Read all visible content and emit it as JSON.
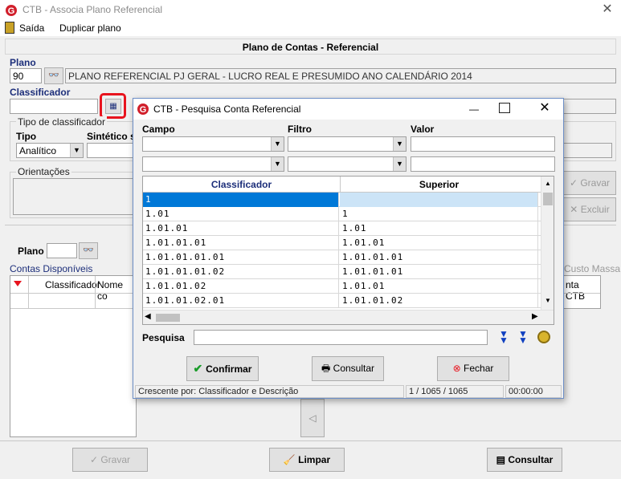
{
  "window": {
    "title": "CTB - Associa Plano Referencial",
    "close": "✕"
  },
  "menu": {
    "exit": "Saída",
    "duplicate": "Duplicar plano"
  },
  "section_title": "Plano de Contas - Referencial",
  "plano": {
    "label": "Plano",
    "value": "90",
    "description": "PLANO REFERENCIAL PJ GERAL - LUCRO REAL E PRESUMIDO ANO CALENDÁRIO 2014"
  },
  "classificador": {
    "label": "Classificador"
  },
  "tipo_group": {
    "label": "Tipo de classificador",
    "tipo_label": "Tipo",
    "tipo_value": "Analítico",
    "sintetico_label": "Sintético s"
  },
  "orientacoes": {
    "label": "Orientações"
  },
  "side_buttons": {
    "gravar": "Gravar",
    "excluir": "Excluir"
  },
  "lower": {
    "plano_label": "Plano",
    "contas_label": "Contas Disponíveis",
    "custo_massa": "Custo Massa",
    "columns": [
      "Classificador",
      "Nome co"
    ],
    "right_col": "nta CTB"
  },
  "bottom": {
    "gravar": "Gravar",
    "limpar": "Limpar",
    "consultar": "Consultar"
  },
  "dialog": {
    "title": "CTB - Pesquisa Conta Referencial",
    "campo": "Campo",
    "filtro": "Filtro",
    "valor": "Valor",
    "columns": [
      "Classificador",
      "Superior"
    ],
    "rows": [
      {
        "c": "1",
        "s": ""
      },
      {
        "c": "1.01",
        "s": "1"
      },
      {
        "c": "1.01.01",
        "s": "1.01"
      },
      {
        "c": "1.01.01.01",
        "s": "1.01.01"
      },
      {
        "c": "1.01.01.01.01",
        "s": "1.01.01.01"
      },
      {
        "c": "1.01.01.01.02",
        "s": "1.01.01.01"
      },
      {
        "c": "1.01.01.02",
        "s": "1.01.01"
      },
      {
        "c": "1.01.01.02.01",
        "s": "1.01.01.02"
      }
    ],
    "pesquisa": "Pesquisa",
    "confirmar": "Confirmar",
    "consultar": "Consultar",
    "fechar": "Fechar",
    "status": {
      "order": "Crescente por: Classificador e Descrição",
      "count": "1 / 1065 / 1065",
      "time": "00:00:00"
    }
  },
  "colors": {
    "accent": "#1c2e7a",
    "selection": "#0078d7",
    "highlight_box": "#e8141e"
  }
}
